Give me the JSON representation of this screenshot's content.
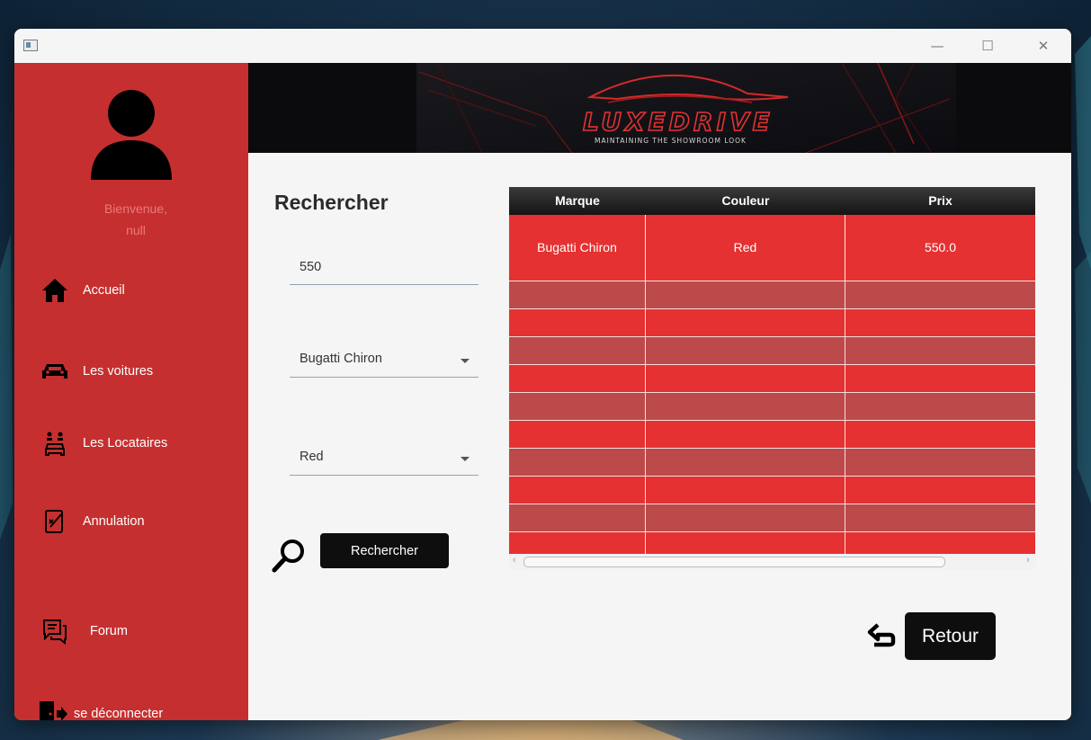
{
  "sidebar": {
    "welcome_line1": "Bienvenue,",
    "welcome_line2": "null",
    "items": [
      {
        "label": "Accueil",
        "icon": "home-icon"
      },
      {
        "label": "Les voitures",
        "icon": "car-icon"
      },
      {
        "label": "Les Locataires",
        "icon": "tenants-icon"
      },
      {
        "label": "Annulation",
        "icon": "cancellation-icon"
      },
      {
        "label": "Forum",
        "icon": "chat-icon"
      },
      {
        "label": "se déconnecter",
        "icon": "logout-icon"
      }
    ]
  },
  "banner": {
    "brand": "LUXEDRIVE",
    "tagline": "MAINTAINING THE SHOWROOM LOOK"
  },
  "search": {
    "title": "Rechercher",
    "price_value": "550",
    "brand_selected": "Bugatti Chiron",
    "color_selected": "Red",
    "button_label": "Rechercher"
  },
  "table": {
    "columns": [
      "Marque",
      "Couleur",
      "Prix"
    ],
    "rows": [
      [
        "Bugatti Chiron",
        "Red",
        "550.0"
      ]
    ]
  },
  "return_button_label": "Retour",
  "colors": {
    "sidebar_red": "#c62f2f",
    "row_red": "#e53131",
    "row_alt": "#bd4a4a",
    "dark": "#0e0e0e"
  }
}
